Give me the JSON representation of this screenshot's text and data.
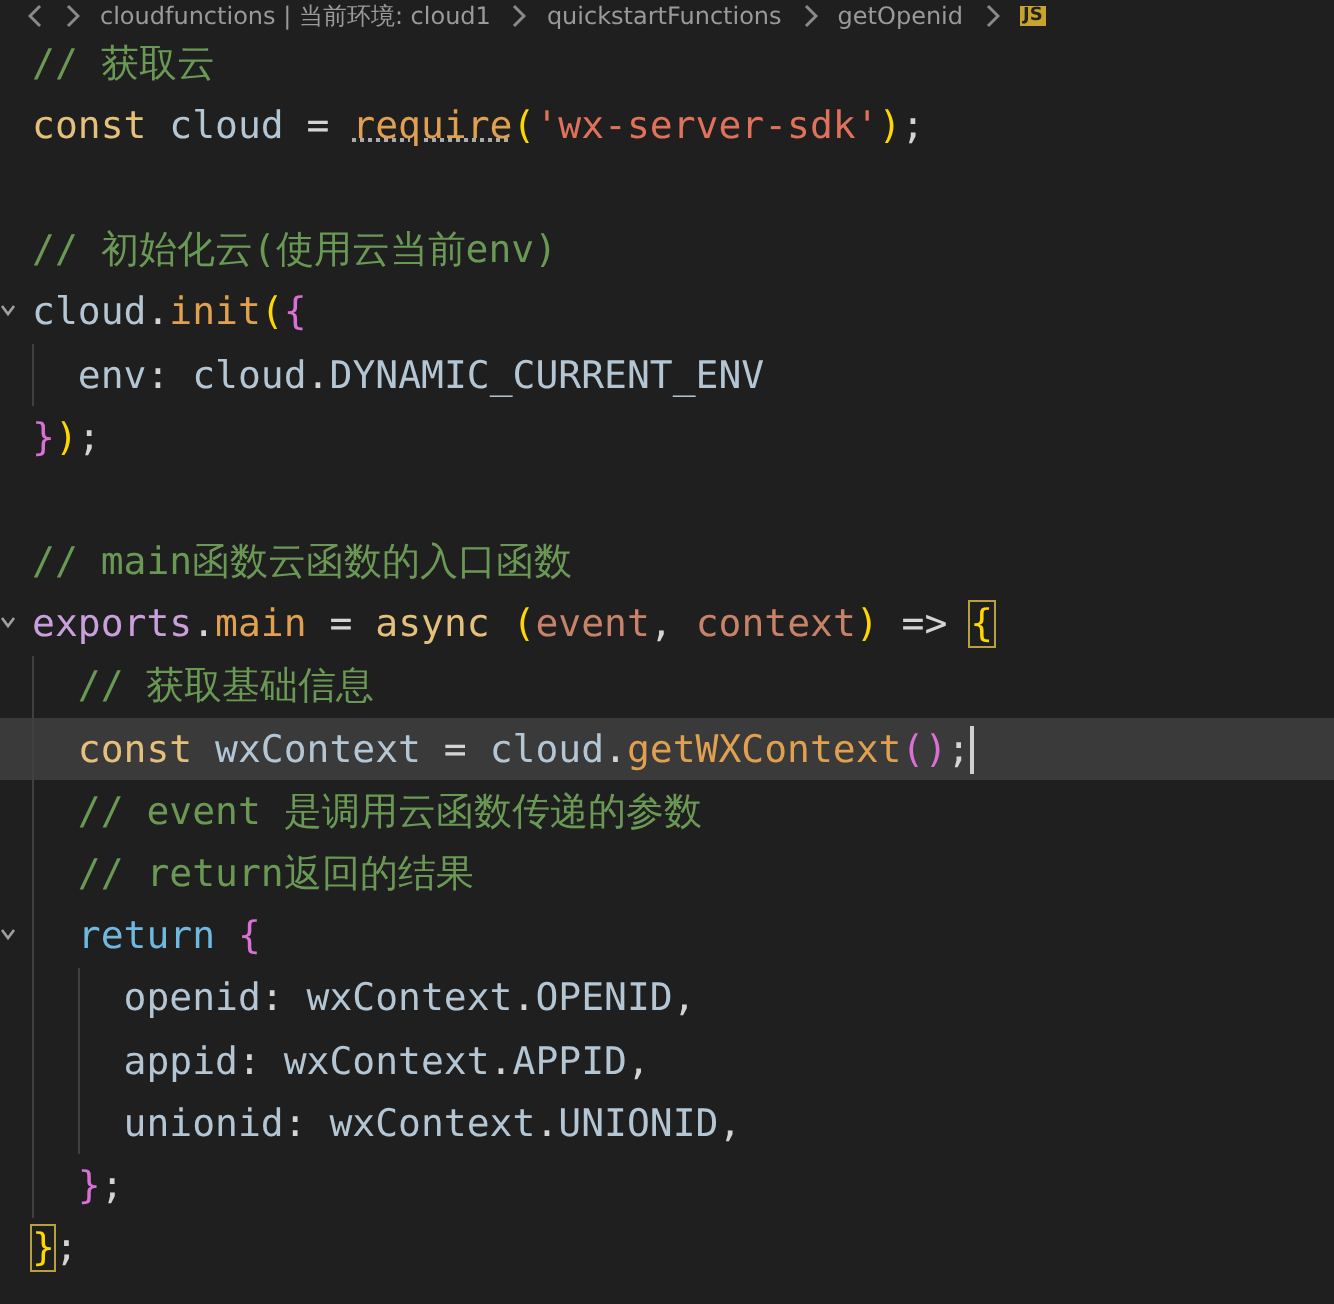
{
  "breadcrumb": {
    "items": [
      "cloudfunctions | 当前环境: cloud1",
      "quickstartFunctions",
      "getOpenid"
    ],
    "file_badge": "JS"
  },
  "lines": [
    {
      "selected": false,
      "fold": false,
      "tokens": [
        {
          "kind": "comment",
          "text": "// 获取云"
        }
      ]
    },
    {
      "selected": false,
      "fold": false,
      "tokens": [
        {
          "kind": "keyword",
          "text": "const"
        },
        {
          "kind": "variable",
          "text": " cloud "
        },
        {
          "kind": "operator",
          "text": "= "
        },
        {
          "kind": "function",
          "text": "require",
          "hint": true
        },
        {
          "kind": "bracket1",
          "text": "("
        },
        {
          "kind": "string",
          "text": "'wx-server-sdk'"
        },
        {
          "kind": "bracket1",
          "text": ")"
        },
        {
          "kind": "punct",
          "text": ";"
        }
      ]
    },
    {
      "selected": false,
      "fold": false
    },
    {
      "selected": false,
      "fold": false,
      "tokens": [
        {
          "kind": "comment",
          "text": "// 初始化云(使用云当前env)"
        }
      ]
    },
    {
      "selected": false,
      "fold": true,
      "tokens": [
        {
          "kind": "variable",
          "text": "cloud"
        },
        {
          "kind": "punct",
          "text": "."
        },
        {
          "kind": "function",
          "text": "init"
        },
        {
          "kind": "bracket1",
          "text": "("
        },
        {
          "kind": "bracket2",
          "text": "{"
        }
      ]
    },
    {
      "selected": false,
      "fold": false,
      "tokens": [
        {
          "kind": "variable",
          "text": "  env"
        },
        {
          "kind": "punct",
          "text": ": "
        },
        {
          "kind": "variable",
          "text": "cloud"
        },
        {
          "kind": "punct",
          "text": "."
        },
        {
          "kind": "variable",
          "text": "DYNAMIC_CURRENT_ENV"
        }
      ]
    },
    {
      "selected": false,
      "fold": false,
      "tokens": [
        {
          "kind": "bracket2",
          "text": "}"
        },
        {
          "kind": "bracket1",
          "text": ")"
        },
        {
          "kind": "punct",
          "text": ";"
        }
      ]
    },
    {
      "selected": false,
      "fold": false
    },
    {
      "selected": false,
      "fold": false,
      "tokens": [
        {
          "kind": "comment",
          "text": "// main函数云函数的入口函数"
        }
      ]
    },
    {
      "selected": false,
      "fold": true,
      "tokens": [
        {
          "kind": "export",
          "text": "exports"
        },
        {
          "kind": "punct",
          "text": "."
        },
        {
          "kind": "function",
          "text": "main"
        },
        {
          "kind": "operator",
          "text": " = "
        },
        {
          "kind": "keyword",
          "text": "async "
        },
        {
          "kind": "bracket1",
          "text": "("
        },
        {
          "kind": "param",
          "text": "event"
        },
        {
          "kind": "punct",
          "text": ", "
        },
        {
          "kind": "param",
          "text": "context"
        },
        {
          "kind": "bracket1",
          "text": ")"
        },
        {
          "kind": "operator",
          "text": " => "
        },
        {
          "kind": "bracket1",
          "text": "{",
          "matched": true
        }
      ]
    },
    {
      "selected": false,
      "fold": false,
      "tokens": [
        {
          "kind": "comment",
          "text": "  // 获取基础信息"
        }
      ]
    },
    {
      "selected": true,
      "fold": false,
      "tokens": [
        {
          "kind": "keyword",
          "text": "  const"
        },
        {
          "kind": "variable",
          "text": " wxContext "
        },
        {
          "kind": "operator",
          "text": "= "
        },
        {
          "kind": "variable",
          "text": "cloud"
        },
        {
          "kind": "punct",
          "text": "."
        },
        {
          "kind": "function",
          "text": "getWXContext"
        },
        {
          "kind": "bracket2",
          "text": "()"
        },
        {
          "kind": "punct",
          "text": ";"
        }
      ]
    },
    {
      "selected": false,
      "fold": false,
      "tokens": [
        {
          "kind": "comment",
          "text": "  // event 是调用云函数传递的参数"
        }
      ]
    },
    {
      "selected": false,
      "fold": false,
      "tokens": [
        {
          "kind": "comment",
          "text": "  // return返回的结果"
        }
      ]
    },
    {
      "selected": false,
      "fold": true,
      "tokens": [
        {
          "kind": "control",
          "text": "  return "
        },
        {
          "kind": "bracket2",
          "text": "{"
        }
      ]
    },
    {
      "selected": false,
      "fold": false,
      "tokens": [
        {
          "kind": "variable",
          "text": "    openid"
        },
        {
          "kind": "punct",
          "text": ": "
        },
        {
          "kind": "variable",
          "text": "wxContext"
        },
        {
          "kind": "punct",
          "text": "."
        },
        {
          "kind": "variable",
          "text": "OPENID"
        },
        {
          "kind": "punct",
          "text": ","
        }
      ]
    },
    {
      "selected": false,
      "fold": false,
      "tokens": [
        {
          "kind": "variable",
          "text": "    appid"
        },
        {
          "kind": "punct",
          "text": ": "
        },
        {
          "kind": "variable",
          "text": "wxContext"
        },
        {
          "kind": "punct",
          "text": "."
        },
        {
          "kind": "variable",
          "text": "APPID"
        },
        {
          "kind": "punct",
          "text": ","
        }
      ]
    },
    {
      "selected": false,
      "fold": false,
      "tokens": [
        {
          "kind": "variable",
          "text": "    unionid"
        },
        {
          "kind": "punct",
          "text": ": "
        },
        {
          "kind": "variable",
          "text": "wxContext"
        },
        {
          "kind": "punct",
          "text": "."
        },
        {
          "kind": "variable",
          "text": "UNIONID"
        },
        {
          "kind": "punct",
          "text": ","
        }
      ]
    },
    {
      "selected": false,
      "fold": false,
      "tokens": [
        {
          "kind": "bracket2",
          "text": "  }"
        },
        {
          "kind": "punct",
          "text": ";"
        }
      ]
    },
    {
      "selected": false,
      "fold": false,
      "tokens": [
        {
          "kind": "bracket1",
          "text": "}",
          "matched": true
        },
        {
          "kind": "punct",
          "text": ";"
        }
      ]
    }
  ]
}
